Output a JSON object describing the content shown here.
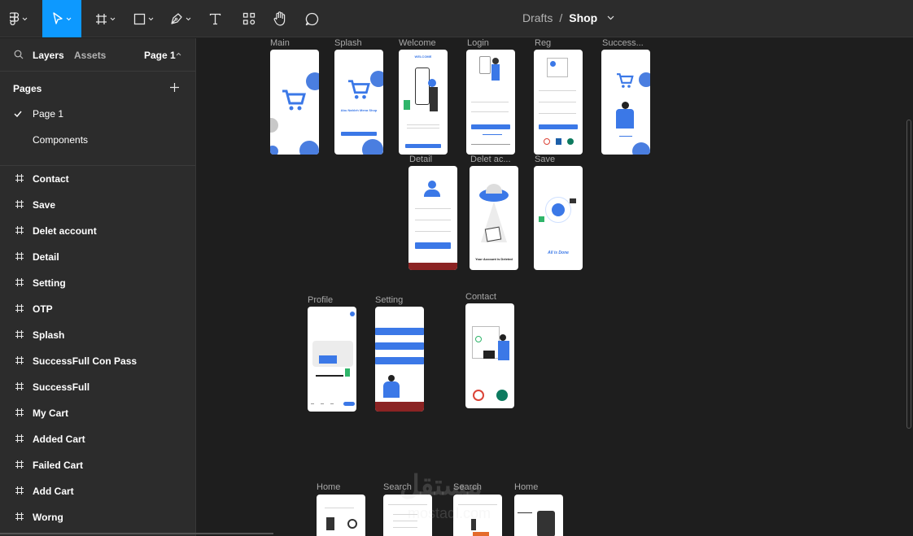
{
  "toolbar": {
    "tools": [
      {
        "name": "main-menu",
        "icon": "figma-logo-icon",
        "dropdown": true
      },
      {
        "name": "move-tool",
        "icon": "cursor-icon",
        "dropdown": true,
        "active": true
      },
      {
        "name": "frame-tool",
        "icon": "frame-hash-icon",
        "dropdown": true
      },
      {
        "name": "shape-tool",
        "icon": "rectangle-icon",
        "dropdown": true
      },
      {
        "name": "pen-tool",
        "icon": "pen-icon",
        "dropdown": true
      },
      {
        "name": "text-tool",
        "icon": "text-icon"
      },
      {
        "name": "resources-tool",
        "icon": "components-icon"
      },
      {
        "name": "hand-tool",
        "icon": "hand-icon"
      },
      {
        "name": "comment-tool",
        "icon": "comment-icon"
      }
    ],
    "breadcrumb": {
      "parent": "Drafts",
      "separator": "/",
      "current": "Shop"
    },
    "active_color": "#0d99ff"
  },
  "sidebar": {
    "tabs": {
      "layers": "Layers",
      "assets": "Assets",
      "page_selector": "Page 1"
    },
    "pages_title": "Pages",
    "pages": [
      {
        "label": "Page 1",
        "selected": true
      },
      {
        "label": "Components",
        "selected": false
      }
    ],
    "layers": [
      "Contact",
      "Save",
      "Delet account",
      "Detail",
      "Setting",
      "OTP",
      "Splash",
      "SuccessFull Con Pass",
      "SuccessFull",
      "My Cart",
      "Added Cart",
      "Failed Cart",
      "Add Cart",
      "Worng"
    ]
  },
  "canvas": {
    "frames": {
      "main": "Main",
      "splash": "Splash",
      "welcome": "Welcome",
      "login": "Login",
      "reg": "Reg",
      "success": "Success...",
      "detail": "Detail",
      "delete": "Delet ac...",
      "save": "Save",
      "profile": "Profile",
      "setting": "Setting",
      "contact": "Contact",
      "home1": "Home",
      "search1": "Search",
      "search2": "Search",
      "home2": "Home"
    },
    "frame_text": {
      "splash_title": "Abu Nahleh Mena Shop",
      "welcome_banner": "WELCOME",
      "delete_msg": "Your Account is Deleted",
      "save_msg": "All is Done"
    },
    "watermark": "مستقل",
    "watermark_url": "mostaql.com"
  },
  "colors": {
    "brand_blue": "#3b78e7",
    "dark_red": "#8b2323",
    "canvas_bg": "#1e1e1e",
    "panel_bg": "#2c2c2c"
  }
}
